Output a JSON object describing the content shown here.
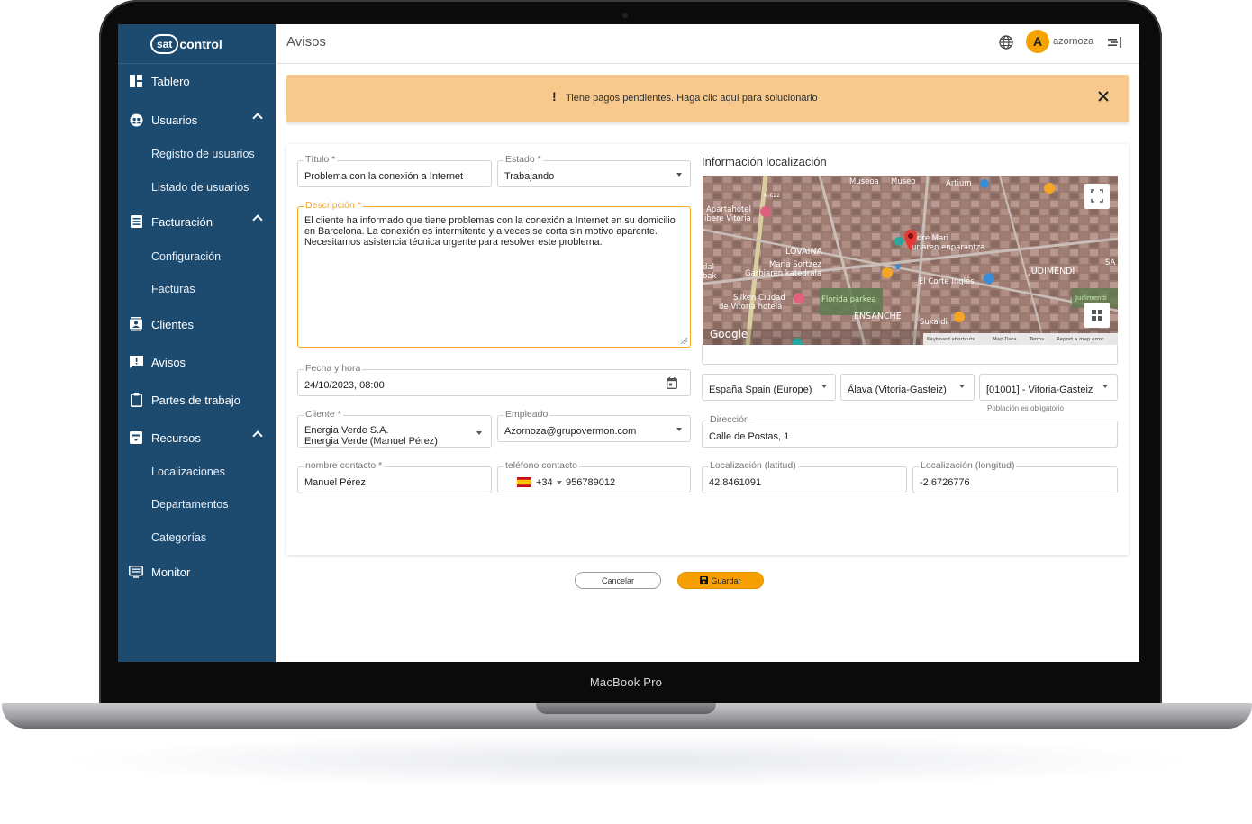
{
  "device": {
    "label": "MacBook Pro"
  },
  "app": {
    "logo_badge": "sat",
    "logo_text": "control"
  },
  "sidebar": {
    "items": [
      {
        "label": "Tablero"
      },
      {
        "label": "Usuarios",
        "children": [
          "Registro de usuarios",
          "Listado de usuarios"
        ]
      },
      {
        "label": "Facturación",
        "children": [
          "Configuración",
          "Facturas"
        ]
      },
      {
        "label": "Clientes"
      },
      {
        "label": "Avisos"
      },
      {
        "label": "Partes de trabajo"
      },
      {
        "label": "Recursos",
        "children": [
          "Localizaciones",
          "Departamentos",
          "Categorías"
        ]
      },
      {
        "label": "Monitor"
      }
    ]
  },
  "header": {
    "title": "Avisos",
    "username": "azornoza",
    "avatar_letter": "A"
  },
  "alert": {
    "text": "Tiene pagos pendientes. Haga clic aquí para solucionarlo",
    "icon": "!"
  },
  "form": {
    "titulo": {
      "label": "Título *",
      "value": "Problema con la conexión a Internet"
    },
    "estado": {
      "label": "Estado *",
      "value": "Trabajando"
    },
    "descripcion": {
      "label": "Descripción *",
      "value": "El cliente ha informado que tiene problemas con la conexión a Internet en su domicilio en Barcelona. La conexión es intermitente y a veces se corta sin motivo aparente. Necesitamos asistencia técnica urgente para resolver este problema."
    },
    "fecha": {
      "label": "Fecha y hora",
      "value": "24/10/2023, 08:00"
    },
    "cliente": {
      "label": "Cliente *",
      "value_line1": "Energia Verde S.A.",
      "value_line2": "Energia Verde (Manuel Pérez)"
    },
    "empleado": {
      "label": "Empleado",
      "value": "Azornoza@grupovermon.com"
    },
    "contacto": {
      "label": "nombre contacto *",
      "value": "Manuel Pérez"
    },
    "telefono": {
      "label": "teléfono contacto",
      "prefix": "+34",
      "value": "956789012"
    }
  },
  "location": {
    "title": "Información localización",
    "map_labels": [
      "Museoa",
      "Museo",
      "Artium",
      "N-622",
      "Apartahotel",
      "ibere Vitoria",
      "LOVAINA",
      "Maria Sortzez",
      "Garbiaren katedrala",
      "dre Mari",
      "uriaren enparantza",
      "JUDIMENDI",
      "dal",
      "bak",
      "El Corte Inglés",
      "SA",
      "Silken Ciudad",
      "de Vitoria hotela",
      "Florida parkea",
      "ENSANCHE",
      "Sukaldi",
      "Judimendi",
      "Google",
      "Keyboard shortcuts",
      "Map Data",
      "Terms",
      "Report a map error"
    ],
    "country": "España Spain (Europe)",
    "province": "Álava (Vitoria-Gasteiz)",
    "city": "[01001] - Vitoria-Gasteiz",
    "city_note": "Población es obligatorio",
    "direccion": {
      "label": "Dirección",
      "value": "Calle de Postas, 1"
    },
    "latitud": {
      "label": "Localización (latitud)",
      "value": "42.8461091"
    },
    "longitud": {
      "label": "Localización (longitud)",
      "value": "-2.6726776"
    }
  },
  "actions": {
    "cancel": "Cancelar",
    "save": "Guardar"
  },
  "colors": {
    "sidebar": "#1d4b70",
    "accent": "#f5a300",
    "alert": "#f7c98c"
  }
}
